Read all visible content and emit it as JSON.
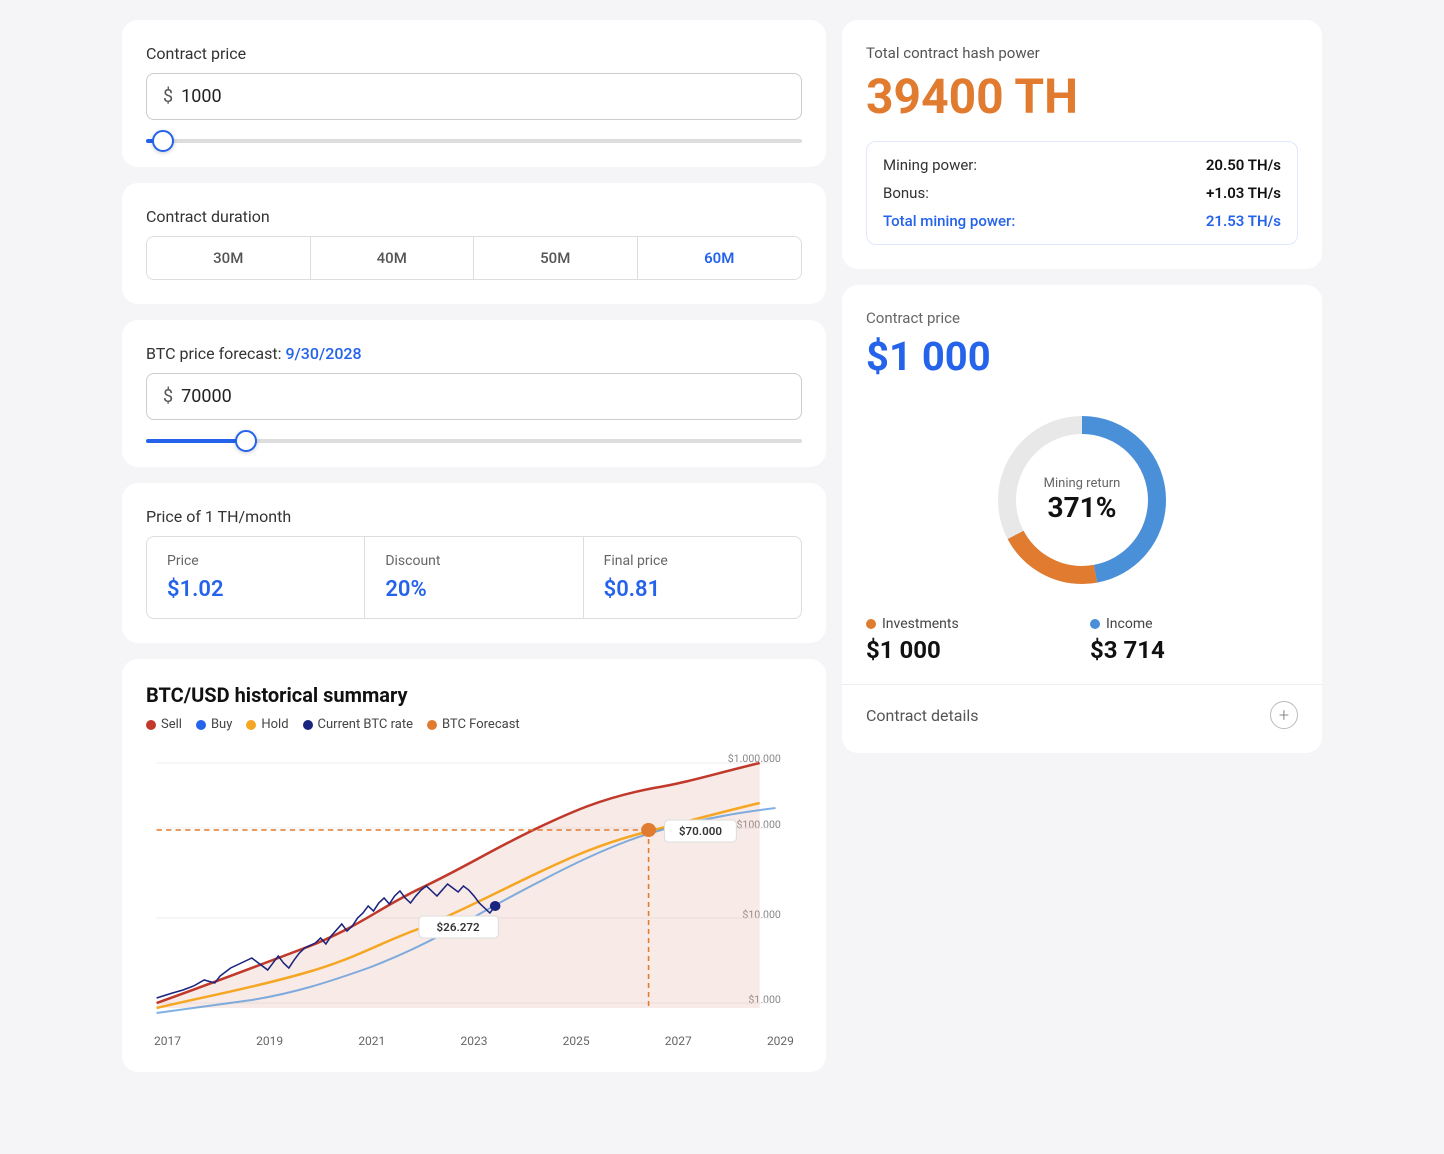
{
  "left": {
    "contract_price_label": "Contract price",
    "contract_price_currency": "$",
    "contract_price_value": "1000",
    "duration_label": "Contract duration",
    "duration_tabs": [
      "30M",
      "40M",
      "50M",
      "60M"
    ],
    "duration_active": 3,
    "btc_forecast_label": "BTC price forecast:",
    "btc_forecast_date": "9/30/2028",
    "btc_price_currency": "$",
    "btc_price_value": "70000",
    "th_month_label": "Price of 1 TH/month",
    "price_cells": [
      {
        "label": "Price",
        "value": "$1.02"
      },
      {
        "label": "Discount",
        "value": "20%"
      },
      {
        "label": "Final price",
        "value": "$0.81"
      }
    ],
    "chart": {
      "title": "BTC/USD historical summary",
      "legend": [
        {
          "label": "Sell",
          "color": "#c0392b"
        },
        {
          "label": "Buy",
          "color": "#2563eb"
        },
        {
          "label": "Hold",
          "color": "#f5a623"
        },
        {
          "label": "Current BTC rate",
          "color": "#1a237e"
        },
        {
          "label": "BTC Forecast",
          "color": "#e07b30"
        }
      ],
      "x_labels": [
        "2017",
        "2019",
        "2021",
        "2023",
        "2025",
        "2027",
        "2029"
      ],
      "y_labels": [
        "$1.000.000",
        "$100.000",
        "$10.000",
        "$1.000"
      ],
      "annotation_current": "$26.272",
      "annotation_forecast": "$70.000"
    }
  },
  "right": {
    "hash_power_title": "Total contract hash power",
    "hash_power_value": "39400 TH",
    "mining_power_label": "Mining power:",
    "mining_power_value": "20.50 TH/s",
    "bonus_label": "Bonus:",
    "bonus_value": "+1.03 TH/s",
    "total_mining_label": "Total mining power:",
    "total_mining_value": "21.53 TH/s",
    "contract_price_label": "Contract price",
    "contract_price_value": "$1 000",
    "donut_label": "Mining return",
    "donut_value": "371%",
    "investments_label": "Investments",
    "investments_value": "$1 000",
    "income_label": "Income",
    "income_value": "$3 714",
    "contract_details_label": "Contract details"
  }
}
